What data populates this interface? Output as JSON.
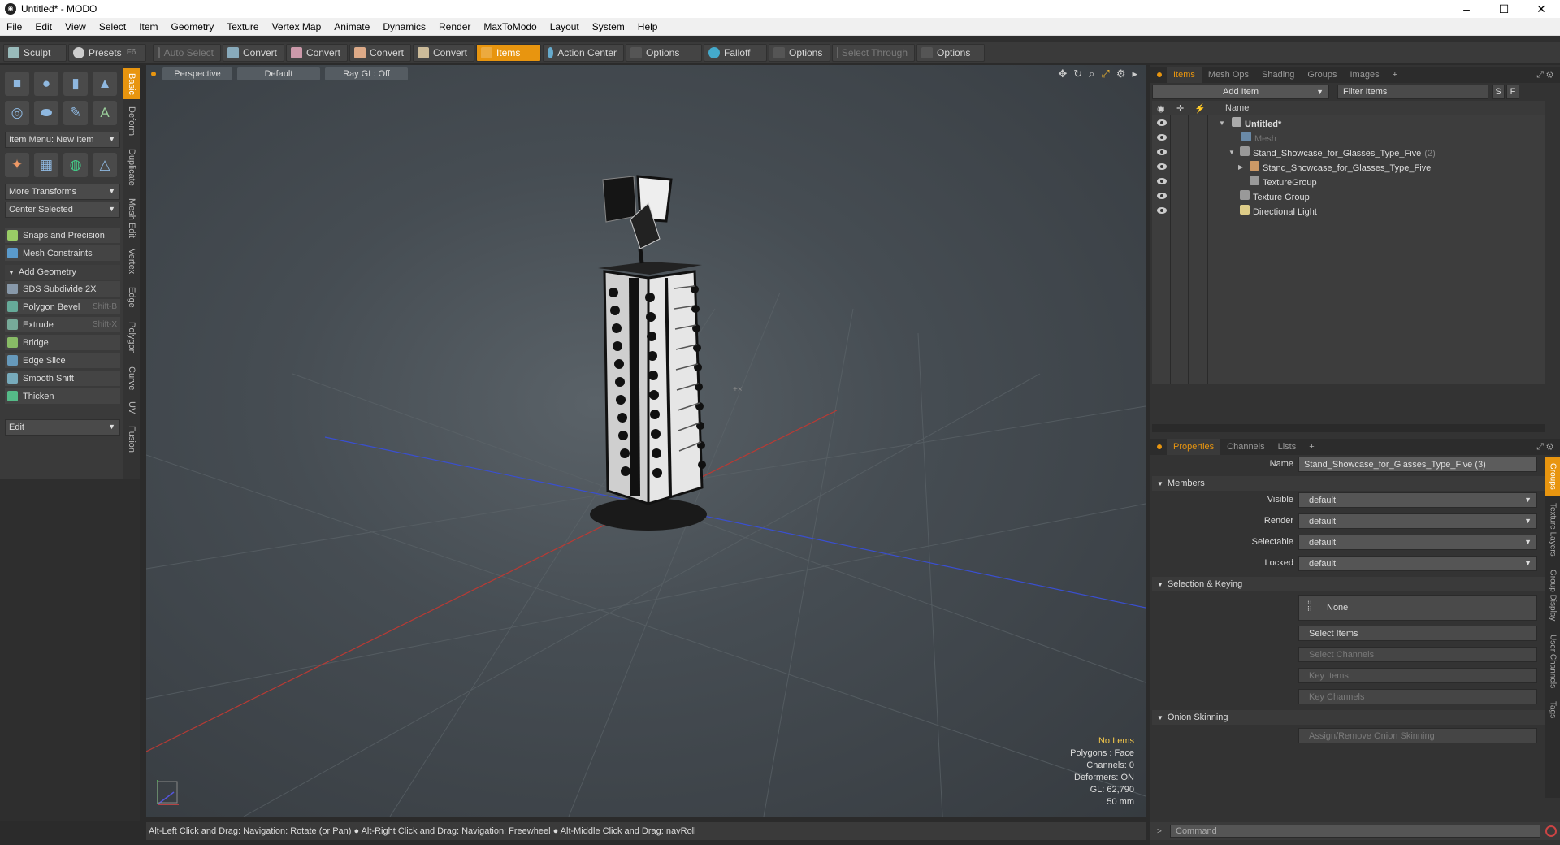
{
  "window": {
    "title": "Untitled* - MODO",
    "minimize": "–",
    "maximize": "☐",
    "close": "✕"
  },
  "menu": [
    "File",
    "Edit",
    "View",
    "Select",
    "Item",
    "Geometry",
    "Texture",
    "Vertex Map",
    "Animate",
    "Dynamics",
    "Render",
    "MaxToModo",
    "Layout",
    "System",
    "Help"
  ],
  "toolbar": {
    "sculpt": "Sculpt",
    "presets": "Presets",
    "presets_shortcut": "F6",
    "auto_select": "Auto Select",
    "convert1": "Convert",
    "convert2": "Convert",
    "convert3": "Convert",
    "convert4": "Convert",
    "items": "Items",
    "action_center": "Action Center",
    "options1": "Options",
    "falloff": "Falloff",
    "options2": "Options",
    "select_through": "Select Through",
    "options3": "Options"
  },
  "left": {
    "item_menu": "Item Menu: New Item",
    "more_transforms": "More Transforms",
    "center_selected": "Center Selected",
    "snaps": "Snaps and Precision",
    "mesh_constraints": "Mesh Constraints",
    "add_geometry": "Add Geometry",
    "tools": [
      {
        "label": "SDS Subdivide 2X",
        "shortcut": ""
      },
      {
        "label": "Polygon Bevel",
        "shortcut": "Shift-B"
      },
      {
        "label": "Extrude",
        "shortcut": "Shift-X"
      },
      {
        "label": "Bridge",
        "shortcut": ""
      },
      {
        "label": "Edge Slice",
        "shortcut": ""
      },
      {
        "label": "Smooth Shift",
        "shortcut": ""
      },
      {
        "label": "Thicken",
        "shortcut": ""
      }
    ],
    "edit": "Edit",
    "vtabs": [
      "Basic",
      "Deform",
      "Duplicate",
      "Mesh Edit",
      "Vertex",
      "Edge",
      "Polygon",
      "Curve",
      "UV",
      "Fusion"
    ]
  },
  "viewport": {
    "perspective": "Perspective",
    "default": "Default",
    "raygl": "Ray GL: Off",
    "stats": {
      "no_items": "No Items",
      "polygons": "Polygons : Face",
      "channels": "Channels: 0",
      "deformers": "Deformers: ON",
      "gl": "GL: 62,790",
      "mm": "50 mm"
    }
  },
  "status": "Alt-Left Click and Drag: Navigation: Rotate (or Pan) ● Alt-Right Click and Drag: Navigation: Freewheel ● Alt-Middle Click and Drag: navRoll",
  "items_panel": {
    "tabs": [
      "Items",
      "Mesh Ops",
      "Shading",
      "Groups",
      "Images",
      "+"
    ],
    "add_item": "Add Item",
    "filter_items": "Filter Items",
    "s_btn": "S",
    "f_btn": "F",
    "name_col": "Name",
    "tree": [
      {
        "label": "Untitled*",
        "count": ""
      },
      {
        "label": "Mesh",
        "count": ""
      },
      {
        "label": "Stand_Showcase_for_Glasses_Type_Five",
        "count": "(2)"
      },
      {
        "label": "Stand_Showcase_for_Glasses_Type_Five",
        "count": ""
      },
      {
        "label": "TextureGroup",
        "count": ""
      },
      {
        "label": "Texture Group",
        "count": ""
      },
      {
        "label": "Directional Light",
        "count": ""
      }
    ]
  },
  "properties": {
    "tabs": [
      "Properties",
      "Channels",
      "Lists",
      "+"
    ],
    "name_label": "Name",
    "name_value": "Stand_Showcase_for_Glasses_Type_Five (3)",
    "members": "Members",
    "visible_label": "Visible",
    "visible_value": "default",
    "render_label": "Render",
    "render_value": "default",
    "selectable_label": "Selectable",
    "selectable_value": "default",
    "locked_label": "Locked",
    "locked_value": "default",
    "sel_keying": "Selection & Keying",
    "none": "None",
    "select_items": "Select Items",
    "select_channels": "Select Channels",
    "key_items": "Key Items",
    "key_channels": "Key Channels",
    "onion": "Onion Skinning",
    "assign_onion": "Assign/Remove Onion Skinning",
    "vtabs": [
      "Groups",
      "Texture Layers",
      "Group Display",
      "User Channels",
      "Tags"
    ]
  },
  "command": {
    "placeholder": "Command"
  },
  "colors": {
    "accent": "#e8950f",
    "x_axis": "#c0392b",
    "z_axis": "#3a4fd0"
  }
}
